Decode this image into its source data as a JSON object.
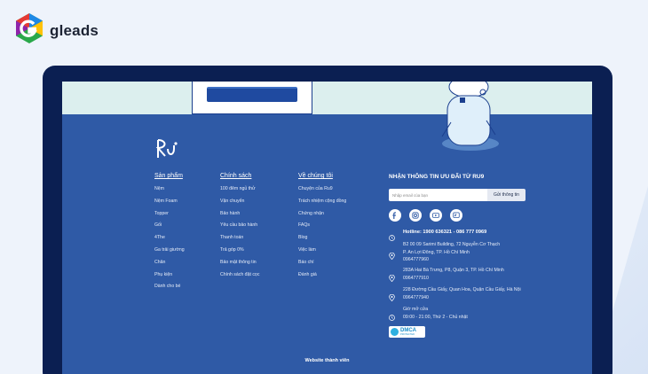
{
  "brand": {
    "name": "gleads",
    "logo_icon": "gleads-hexagon-logo-icon"
  },
  "site": {
    "logo_text": "Rǔ"
  },
  "columns": [
    {
      "heading": "Sản phẩm",
      "items": [
        "Nệm",
        "Nệm Foam",
        "Topper",
        "Gối",
        "4The",
        "Ga trải giường",
        "Chăn",
        "Phụ kiện",
        "Dành cho bé"
      ]
    },
    {
      "heading": "Chính sách",
      "items": [
        "100 đêm ngủ thử",
        "Vận chuyển",
        "Bảo hành",
        "Yêu cầu bảo hành",
        "Thanh toán",
        "Trả góp 0%",
        "Bảo mật thông tin",
        "Chính sách đặt cọc"
      ]
    },
    {
      "heading": "Về chúng tôi",
      "items": [
        "Chuyện của Ru9",
        "Trách nhiệm cộng đồng",
        "Chứng nhận",
        "FAQs",
        "Blog",
        "Việc làm",
        "Báo chí",
        "Đánh giá"
      ]
    }
  ],
  "newsletter": {
    "title": "NHẬN THÔNG TIN ƯU ĐÃI TỪ RU9",
    "placeholder": "Nhập email của bạn",
    "button": "Gửi thông tin"
  },
  "socials": [
    "facebook-icon",
    "instagram-icon",
    "youtube-icon",
    "zalo-icon"
  ],
  "contact": {
    "hotline": "Hotline: 1900 636321 - 086 777 0969",
    "addresses": [
      {
        "line1": "B2 00 09 Sarimi Building, 72 Nguyễn Cơ Thạch",
        "line2": "P. An Lợi Đông, TP. Hồ Chí Minh",
        "line3": "0964777960"
      },
      {
        "line1": "283A Hai Bà Trưng, P8, Quận 3, TP. Hồ Chí Minh",
        "line2": "0964777910"
      },
      {
        "line1": "228 Đường Cầu Giấy, Quan Hoa, Quận Cầu Giấy, Hà Nội",
        "line2": "0964777940"
      }
    ],
    "hours_label": "Giờ mở cửa",
    "hours": "09:00 - 21:00, Thứ 2 - Chủ nhật"
  },
  "dmca": {
    "title": "DMCA",
    "subtitle": "PROTECTED"
  },
  "footer": {
    "link": "Website thành viên"
  },
  "colors": {
    "footer_bg": "#2f5aa6",
    "laptop_frame": "#0b1f52",
    "page_bg": "#eef3fb"
  }
}
